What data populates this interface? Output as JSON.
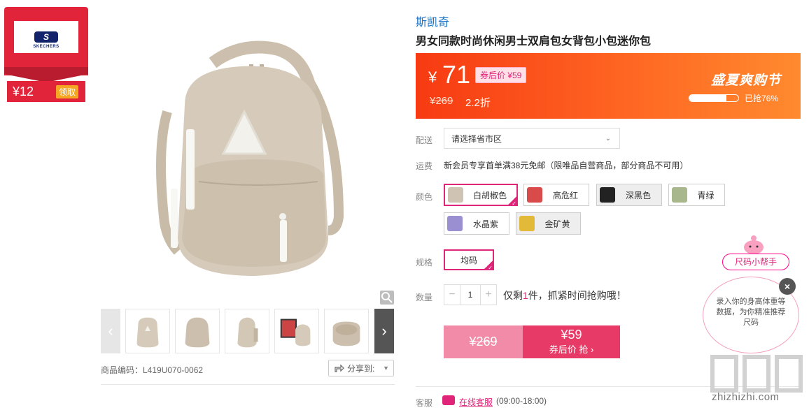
{
  "coupon": {
    "brand_logo_text": "SKECHERS",
    "amount": "¥12",
    "claim_label": "领取"
  },
  "brand": "斯凯奇",
  "product_title": "男女同款时尚休闲男士双肩包女背包小包迷你包",
  "price": {
    "currency": "¥",
    "current": "71",
    "after_coupon_label": "券后价 ¥59",
    "original": "¥269",
    "discount": "2.2折",
    "event_name": "盛夏爽购节",
    "sold_label": "已抢76%",
    "sold_fraction": 0.76
  },
  "labels": {
    "delivery": "配送",
    "shipping": "运费",
    "color": "颜色",
    "size": "规格",
    "quantity": "数量",
    "service": "客服"
  },
  "delivery_placeholder": "请选择省市区",
  "shipping_text": "新会员专享首单满38元免邮（限唯品自营商品，部分商品不可用）",
  "colors": [
    {
      "label": "白胡椒色",
      "selected": true,
      "swatch": "#cfc4b4"
    },
    {
      "label": "高危红",
      "selected": false,
      "swatch": "#d94a4a"
    },
    {
      "label": "深黑色",
      "selected": false,
      "swatch": "#222222"
    },
    {
      "label": "青绿",
      "selected": false,
      "swatch": "#a9b88c"
    },
    {
      "label": "水晶紫",
      "selected": false,
      "swatch": "#9a8fd0"
    },
    {
      "label": "金矿黄",
      "selected": false,
      "swatch": "#e3b93a"
    }
  ],
  "size_option": "均码",
  "quantity": {
    "minus": "−",
    "value": "1",
    "plus": "+"
  },
  "stock": {
    "prefix": "仅剩",
    "count": "1",
    "suffix": "件，抓紧时间抢购哦！"
  },
  "buy_button": {
    "original": "¥269",
    "price": "¥59",
    "action": "券后价 抢 ›"
  },
  "sku_code": "商品编码：L419U070-0062",
  "share_label": "分享到:",
  "service": {
    "link": "在线客服",
    "hours": "(09:00-18:00)"
  },
  "size_helper": {
    "title": "尺码小帮手",
    "text": "录入你的身高体重等数据，为你精准推荐尺码"
  },
  "watermark": "zhizhizhi.com",
  "colors_theme": {
    "accent": "#e0247a",
    "banner": "#f73a12",
    "link": "#1a73c5"
  }
}
